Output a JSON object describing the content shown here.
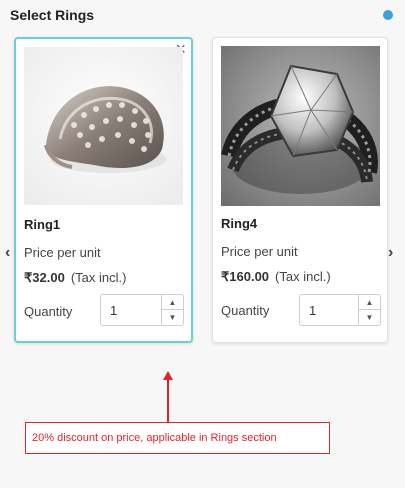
{
  "header": {
    "title": "Select Rings"
  },
  "colors": {
    "accent": "#6ccfd3",
    "dot": "#3aa0e0",
    "annotation": "#e0242c"
  },
  "products": [
    {
      "name": "Ring1",
      "price_label": "Price per unit",
      "price": "₹32.00",
      "tax": "(Tax incl.)",
      "quantity_label": "Quantity",
      "quantity": "1",
      "selected": true
    },
    {
      "name": "Ring4",
      "price_label": "Price per unit",
      "price": "₹160.00",
      "tax": "(Tax incl.)",
      "quantity_label": "Quantity",
      "quantity": "1",
      "selected": false
    }
  ],
  "annotation": {
    "text": "20% discount on price, applicable in Rings section"
  },
  "nav": {
    "left_icon": "chevron-left-icon",
    "right_icon": "chevron-right-icon"
  }
}
